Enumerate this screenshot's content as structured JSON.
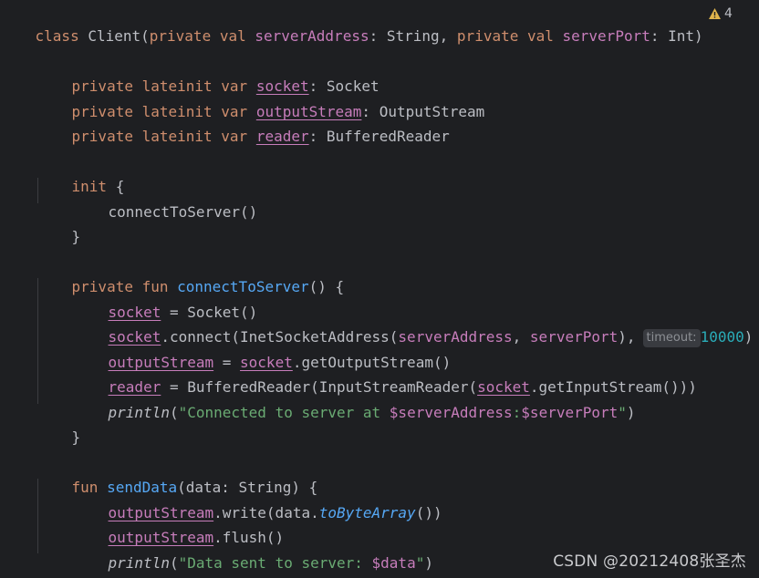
{
  "warnings": {
    "count": "4",
    "icon": "warning-triangle-icon",
    "color": "#e0b44c"
  },
  "code": {
    "l1": {
      "kw_class": "class ",
      "name": "Client(",
      "kw1": "private val ",
      "p1": "serverAddress",
      "t1": ": String, ",
      "kw2": "private val ",
      "p2": "serverPort",
      "t2": ": Int)"
    },
    "l3": {
      "kw": "private lateinit var ",
      "prop": "socket",
      "rest": ": Socket"
    },
    "l4": {
      "kw": "private lateinit var ",
      "prop": "outputStream",
      "rest": ": OutputStream"
    },
    "l5": {
      "kw": "private lateinit var ",
      "prop": "reader",
      "rest": ": BufferedReader"
    },
    "l7": {
      "kw": "init",
      "rest": " {"
    },
    "l8": {
      "text": "connectToServer()"
    },
    "l9": {
      "text": "}"
    },
    "l11": {
      "kw": "private fun ",
      "fn": "connectToServer",
      "rest": "() {"
    },
    "l12": {
      "prop": "socket",
      "rest": " = Socket()"
    },
    "l13": {
      "prop": "socket",
      "a": ".connect(InetSocketAddress(",
      "p1": "serverAddress",
      "b": ", ",
      "p2": "serverPort",
      "c": "),",
      "hint": "timeout:",
      "num": "10000",
      "d": ")"
    },
    "l14": {
      "prop": "outputStream",
      "a": " = ",
      "prop2": "socket",
      "b": ".getOutputStream()"
    },
    "l15": {
      "prop": "reader",
      "a": " = BufferedReader(InputStreamReader(",
      "prop2": "socket",
      "b": ".getInputStream()))"
    },
    "l16": {
      "fn": "println",
      "a": "(",
      "s1": "\"Connected to server at ",
      "t1": "$serverAddress",
      "s2": ":",
      "t2": "$serverPort",
      "s3": "\"",
      "b": ")"
    },
    "l17": {
      "text": "}"
    },
    "l19": {
      "kw": "fun ",
      "fn": "sendData",
      "rest": "(data: String) {"
    },
    "l20": {
      "prop": "outputStream",
      "a": ".write(data.",
      "fn": "toByteArray",
      "b": "())"
    },
    "l21": {
      "prop": "outputStream",
      "a": ".flush()"
    },
    "l22": {
      "fn": "println",
      "a": "(",
      "s1": "\"Data sent to server: ",
      "t1": "$data",
      "s2": "\"",
      "b": ")"
    },
    "l23": {
      "text": "}"
    }
  },
  "watermark": "CSDN @20212408张圣杰"
}
